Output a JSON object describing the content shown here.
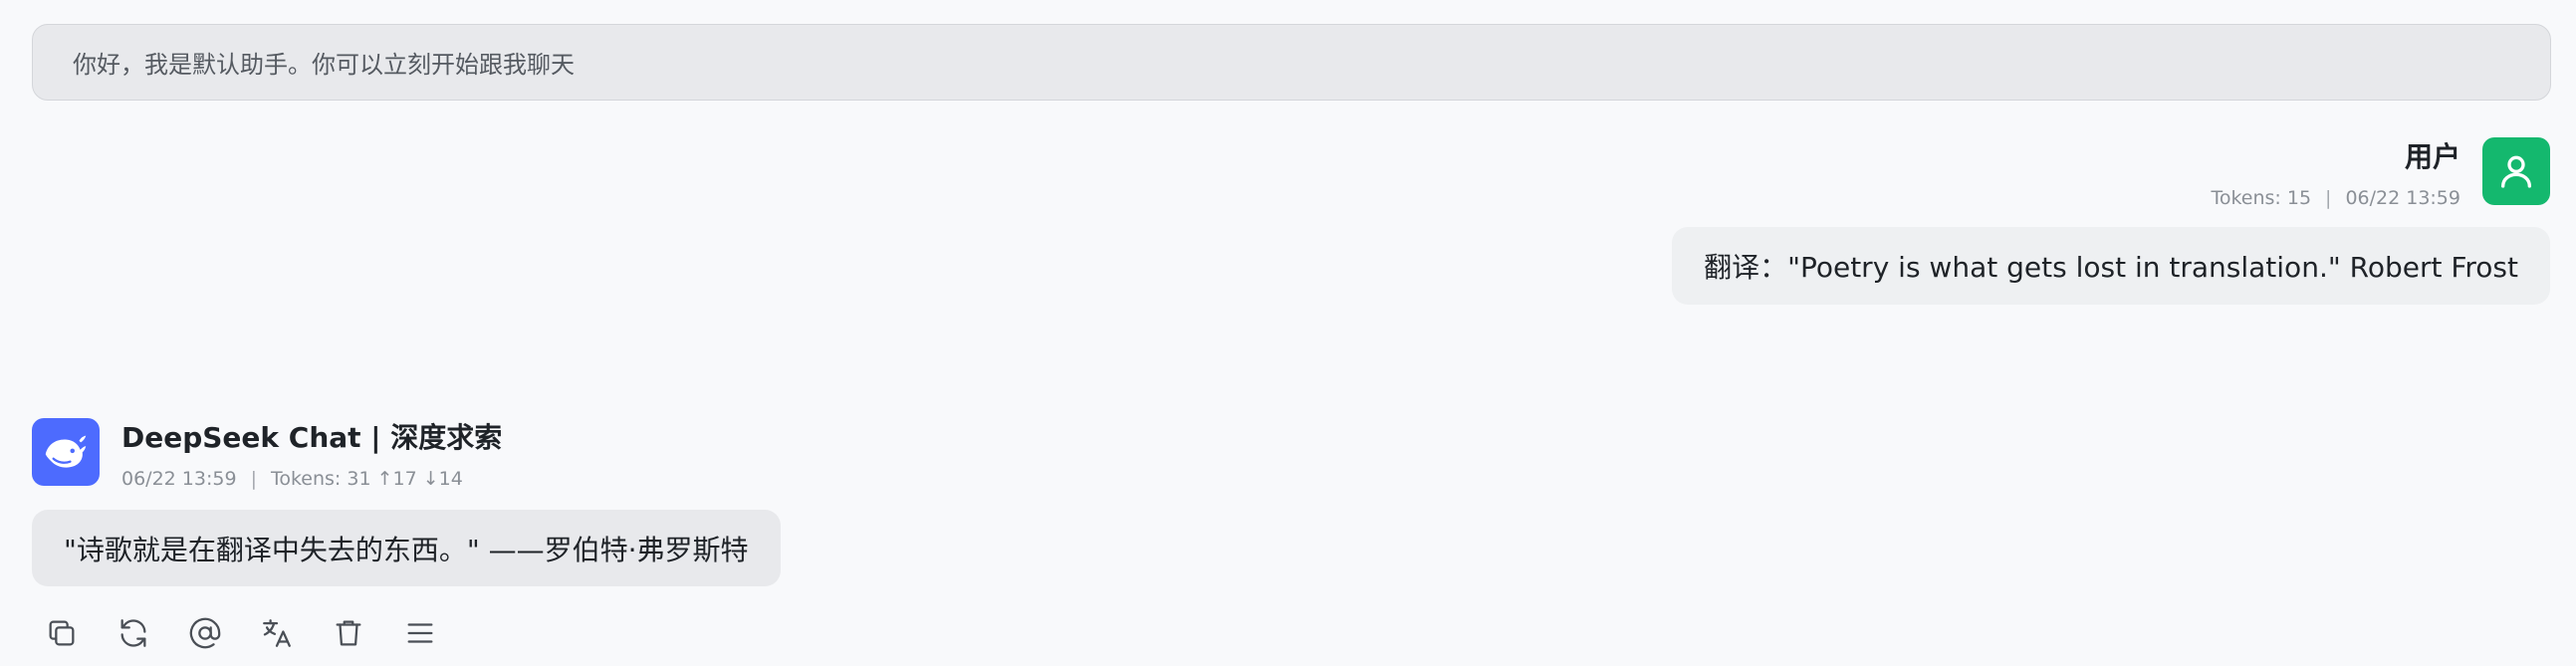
{
  "system_message": "你好，我是默认助手。你可以立刻开始跟我聊天",
  "user_message": {
    "name": "用户",
    "tokens": "Tokens: 15",
    "time": "06/22 13:59",
    "text": "翻译：\"Poetry is what gets lost in translation.\" Robert Frost",
    "avatar_icon": "user-icon",
    "avatar_color": "#14b86e"
  },
  "bot_message": {
    "name": "DeepSeek Chat | 深度求索",
    "time": "06/22 13:59",
    "tokens": "Tokens: 31 ↑17 ↓14",
    "text": "\"诗歌就是在翻译中失去的东西。\" ——罗伯特·弗罗斯特",
    "avatar_icon": "deepseek-whale-icon",
    "avatar_color": "#4d6bfe"
  },
  "actions": [
    {
      "name": "copy",
      "icon": "copy-icon"
    },
    {
      "name": "regenerate",
      "icon": "refresh-icon"
    },
    {
      "name": "mention",
      "icon": "at-icon"
    },
    {
      "name": "translate",
      "icon": "translate-icon"
    },
    {
      "name": "delete",
      "icon": "trash-icon"
    },
    {
      "name": "more",
      "icon": "menu-icon"
    }
  ],
  "meta_separator": "|"
}
